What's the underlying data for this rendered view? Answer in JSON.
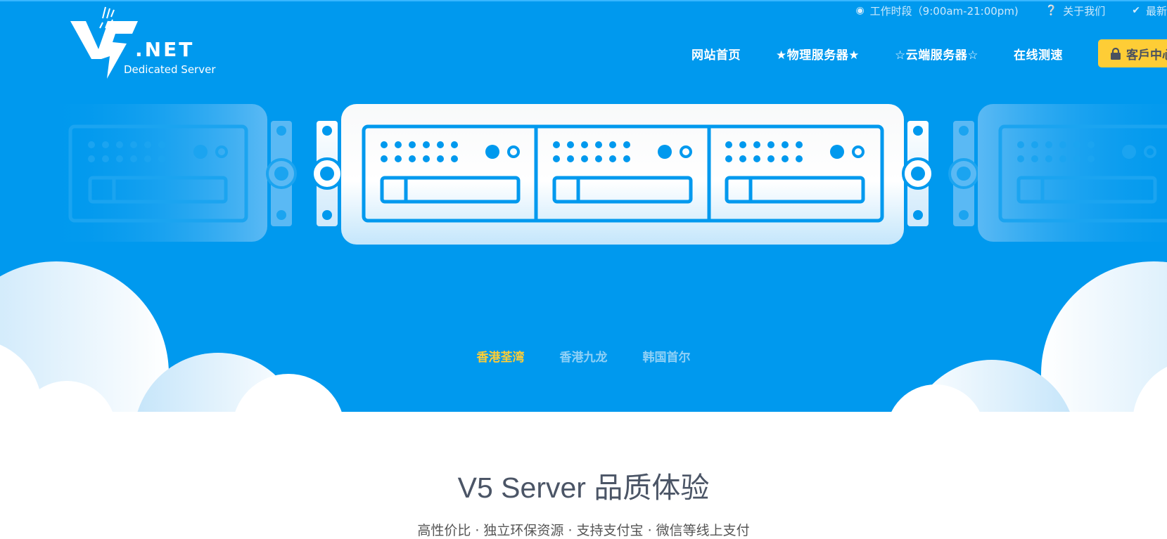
{
  "brand": {
    "logo_mark": "V5",
    "logo_suffix": ".NET",
    "tagline": "Dedicated Server"
  },
  "topbar": {
    "items": [
      {
        "icon": "chat-bubble-icon",
        "label": "工作时段（9:00am-21:00pm)"
      },
      {
        "icon": "question-circle-icon",
        "label": "关于我们"
      },
      {
        "icon": "check-icon",
        "label": "最新动态"
      }
    ]
  },
  "nav": {
    "items": [
      {
        "label": "网站首页"
      },
      {
        "label": "★物理服务器★"
      },
      {
        "label": "☆云端服务器☆"
      },
      {
        "label": "在线测速"
      }
    ],
    "client_button": {
      "icon": "lock-icon",
      "label": "客戶中心"
    }
  },
  "hero": {
    "tabs": [
      {
        "label": "香港荃湾",
        "active": true
      },
      {
        "label": "香港九龙",
        "active": false
      },
      {
        "label": "韩国首尔",
        "active": false
      }
    ]
  },
  "section": {
    "title": "V5 Server 品质体验",
    "subtitle": "高性价比 · 独立环保资源 · 支持支付宝 · 微信等线上支付"
  },
  "colors": {
    "hero_blue": "#0099ee",
    "accent_yellow": "#fecd36",
    "title_gray": "#4b5566"
  }
}
